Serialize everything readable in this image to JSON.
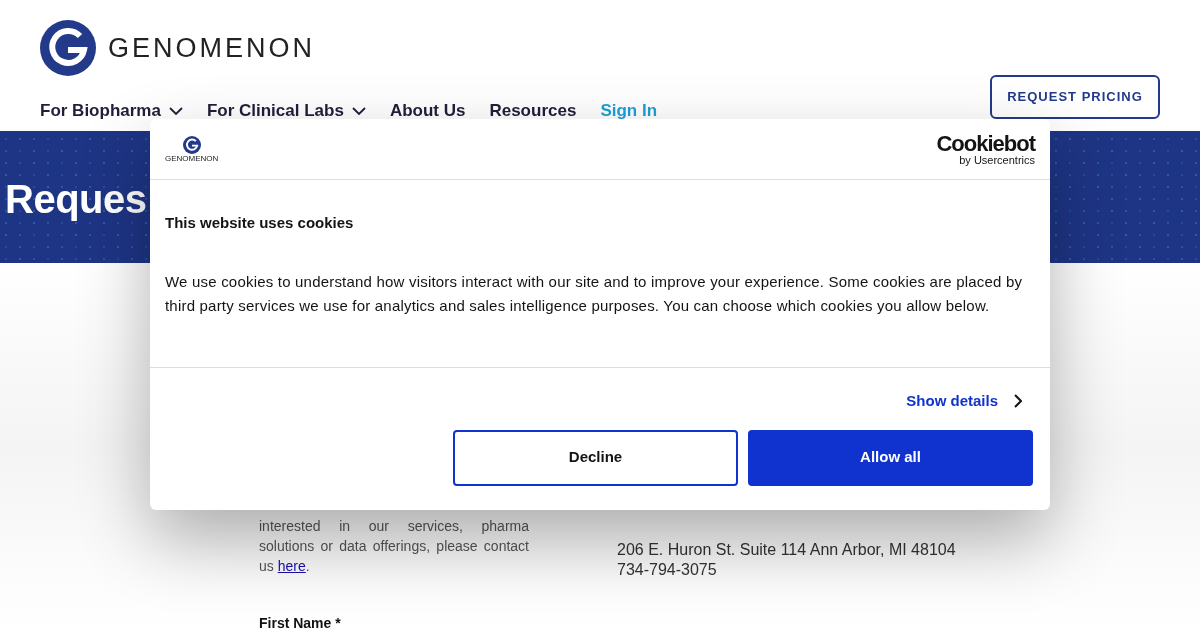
{
  "header": {
    "brand": "GENOMENON",
    "nav": [
      {
        "label": "For Biopharma",
        "dropdown": true,
        "kind": "menu"
      },
      {
        "label": "For Clinical Labs",
        "dropdown": true,
        "kind": "menu"
      },
      {
        "label": "About Us",
        "dropdown": false,
        "kind": "menu"
      },
      {
        "label": "Resources",
        "dropdown": false,
        "kind": "menu"
      },
      {
        "label": "Sign In",
        "dropdown": false,
        "kind": "signin"
      }
    ],
    "cta": "REQUEST PRICING"
  },
  "banner": {
    "title": "Reques"
  },
  "content": {
    "intro": "interested in our services, pharma solutions or data offerings, please contact us ",
    "intro_link": "here",
    "intro_end": ".",
    "address": "206 E. Huron St. Suite 114 Ann Arbor, MI 48104",
    "phone": "734-794-3075",
    "field_label": "First Name *"
  },
  "cookie_dialog": {
    "brand": "GENOMENON",
    "provider": "Cookiebot",
    "provider_sub": "by Usercentrics",
    "title": "This website uses cookies",
    "body": "We use cookies to understand how visitors interact with our site and to improve your experience. Some cookies are placed by third party services we use for analytics and sales intelligence purposes. You can choose which cookies you allow below.",
    "details_link": "Show details",
    "buttons": [
      {
        "label": "Decline",
        "kind": "outline"
      },
      {
        "label": "Allow all",
        "kind": "primary"
      }
    ]
  }
}
